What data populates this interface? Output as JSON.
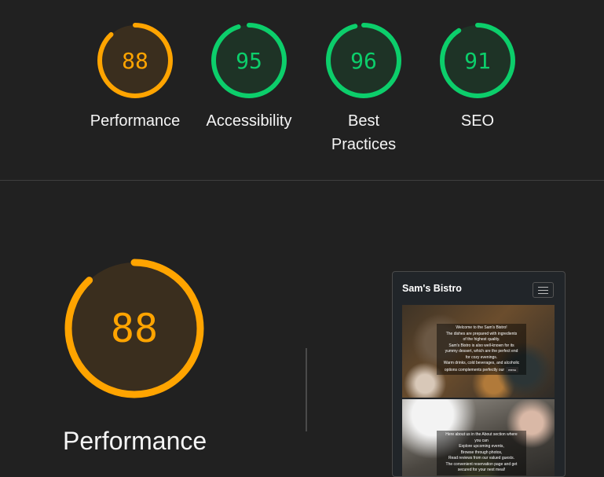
{
  "summary": [
    {
      "label": "Performance",
      "value": "88",
      "score": 0.88,
      "color": "#ffa400",
      "fill": "#3a2e1e"
    },
    {
      "label": "Accessibility",
      "value": "95",
      "score": 0.95,
      "color": "#0cce6b",
      "fill": "#1e3326"
    },
    {
      "label": "Best Practices",
      "label_line1": "Best",
      "label_line2": "Practices",
      "value": "96",
      "score": 0.96,
      "color": "#0cce6b",
      "fill": "#1e3326"
    },
    {
      "label": "SEO",
      "value": "91",
      "score": 0.91,
      "color": "#0cce6b",
      "fill": "#1e3326"
    }
  ],
  "detail": {
    "label": "Performance",
    "value": "88",
    "score": 0.88,
    "color": "#ffa400",
    "fill": "#3a2e1e"
  },
  "screenshot": {
    "site_title": "Sam's Bistro",
    "menu_icon": "hamburger-icon",
    "hero1_lines": [
      "Welcome to the Sam's Bistro!",
      "The dishes are prepared with ingredients",
      "of the highest quality.",
      "Sam's Bistro is also well-known for its",
      "yummy dessert, which are the perfect end",
      "for cozy evenings.",
      "Warm drinks, cold beverages, and alcoholic",
      "options complements perfectly our"
    ],
    "hero1_button": "menu",
    "hero2_lines": [
      "Here about us in the About section where",
      "you can",
      "Explore upcoming events,",
      "Browse through photos,",
      "Read reviews from our valued guests.",
      "The convenient reservation page and get",
      "secured for your next meal!"
    ]
  }
}
